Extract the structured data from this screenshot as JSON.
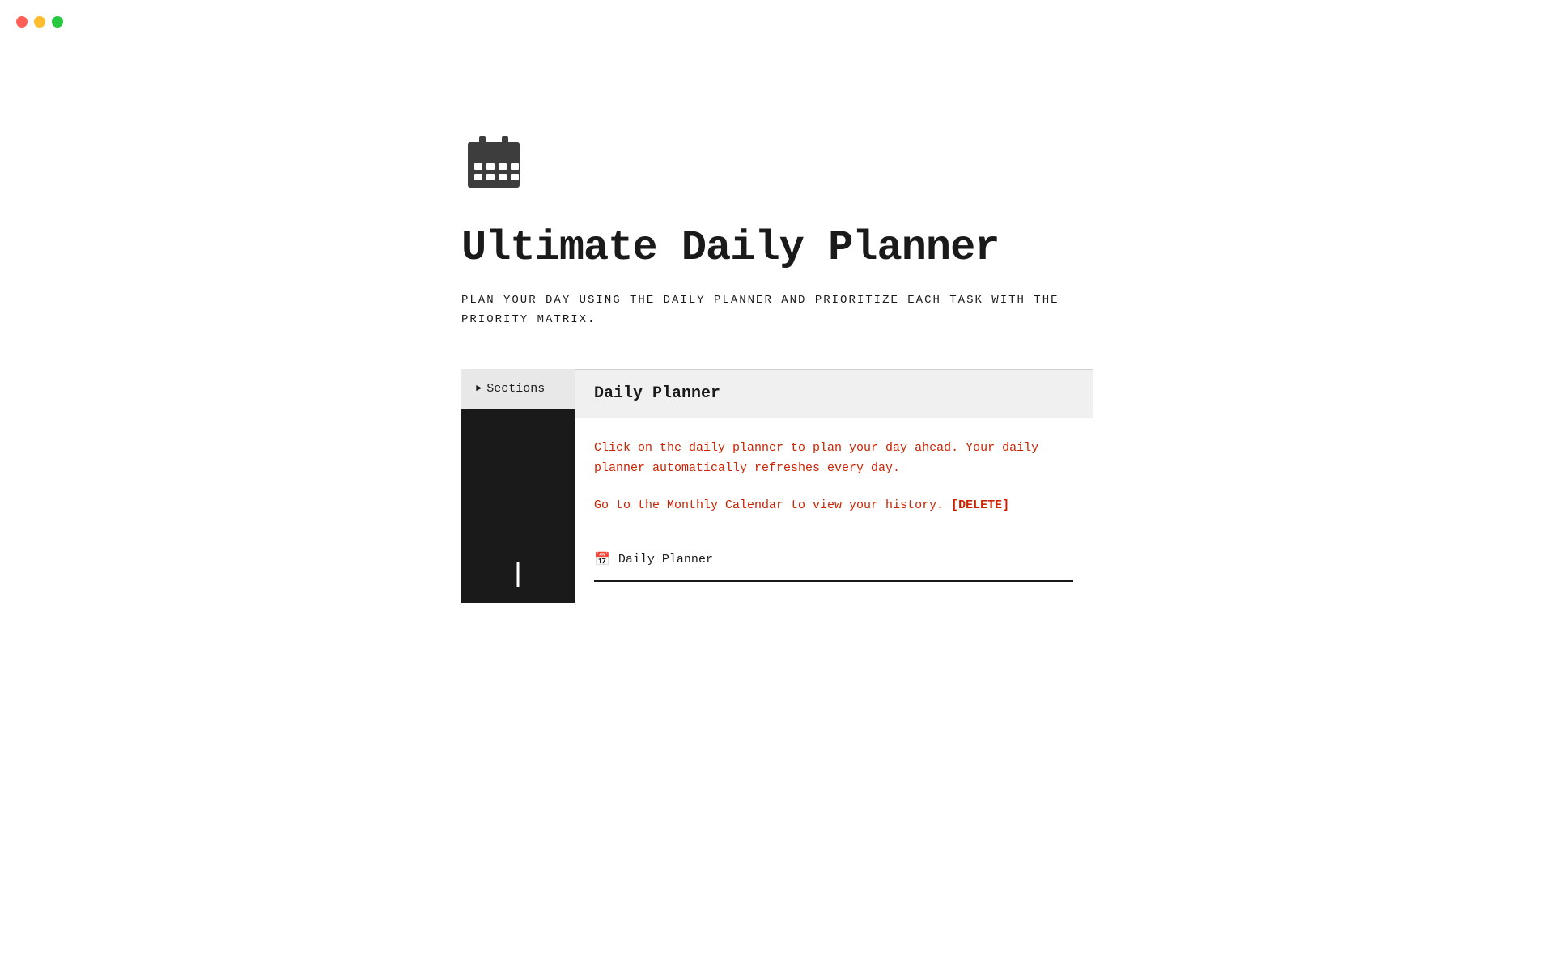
{
  "window": {
    "traffic_lights": {
      "red_label": "close",
      "yellow_label": "minimize",
      "green_label": "maximize"
    }
  },
  "page": {
    "icon_label": "calendar-icon",
    "title": "Ultimate Daily Planner",
    "subtitle": "PLAN YOUR DAY USING THE DAILY PLANNER AND PRIORITIZE EACH TASK WITH THE PRIORITY MATRIX.",
    "sidebar": {
      "sections_label": "Sections"
    },
    "daily_planner_section": {
      "header": "Daily Planner",
      "description_1": "Click on the daily planner to plan your day ahead. Your daily planner automatically refreshes every day.",
      "description_2_prefix": "Go to the Monthly Calendar to view your history.",
      "delete_label": "[DELETE]",
      "link_label": "Daily Planner"
    }
  },
  "detected_text": {
    "monthly": "Monthly",
    "to": "to",
    "daily_planner": "Daily Planner",
    "the": "the"
  }
}
